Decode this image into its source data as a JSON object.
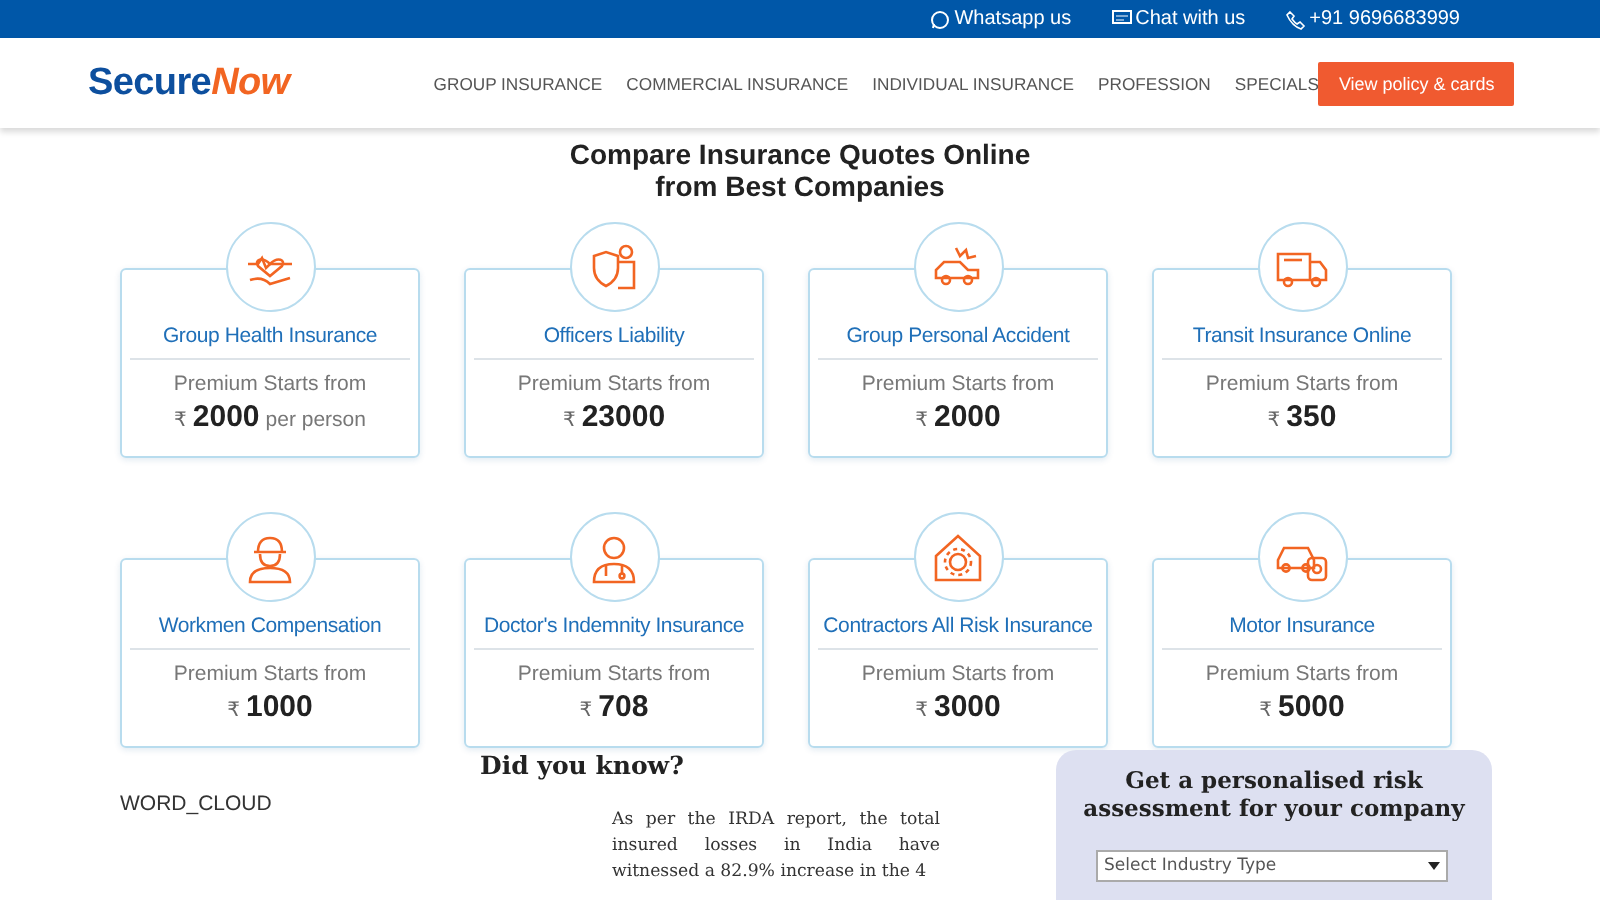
{
  "top_bar": {
    "links": [
      {
        "kind": "whatsapp",
        "label": "Whatsapp us"
      },
      {
        "kind": "chat",
        "label": "Chat with us"
      },
      {
        "kind": "phone",
        "label": "+91 9696683999"
      }
    ]
  },
  "header": {
    "logo": {
      "part_1": "Secure",
      "part_2": "Now"
    },
    "nav": [
      "GROUP INSURANCE",
      "COMMERCIAL INSURANCE",
      "INDIVIDUAL INSURANCE",
      "PROFESSION",
      "SPECIALS"
    ],
    "cta": "View policy & cards"
  },
  "heading": {
    "line_1": "Compare Insurance Quotes Online",
    "line_2": "from Best Companies"
  },
  "products": [
    {
      "kind": "health",
      "title": "Group Health Insurance",
      "label": "Premium Starts from",
      "currency": "₹",
      "price": "2000",
      "unit": "per person"
    },
    {
      "kind": "officer",
      "title": "Officers Liability",
      "label": "Premium Starts from",
      "currency": "₹",
      "price": "23000"
    },
    {
      "kind": "accident",
      "title": "Group Personal Accident",
      "label": "Premium Starts from",
      "currency": "₹",
      "price": "2000"
    },
    {
      "kind": "truck",
      "title": "Transit Insurance Online",
      "label": "Premium Starts from",
      "currency": "₹",
      "price": "350"
    },
    {
      "kind": "worker",
      "title": "Workmen Compensation",
      "label": "Premium Starts from",
      "currency": "₹",
      "price": "1000"
    },
    {
      "kind": "doctor",
      "title": "Doctor's Indemnity Insurance",
      "label": "Premium Starts from",
      "currency": "₹",
      "price": "708"
    },
    {
      "kind": "contractor",
      "title": "Contractors All Risk Insurance",
      "label": "Premium Starts from",
      "currency": "₹",
      "price": "3000"
    },
    {
      "kind": "motor",
      "title": "Motor Insurance",
      "label": "Premium Starts from",
      "currency": "₹",
      "price": "5000"
    }
  ],
  "word_cloud": "WORD_CLOUD",
  "did_you_know": {
    "title": "Did you know?",
    "text": "As per the IRDA report, the total insured losses in India have witnessed a 82.9% increase in the 4"
  },
  "risk_panel": {
    "title": "Get a personalised risk assessment for your company",
    "select": {
      "placeholder": "Select Industry Type"
    }
  }
}
